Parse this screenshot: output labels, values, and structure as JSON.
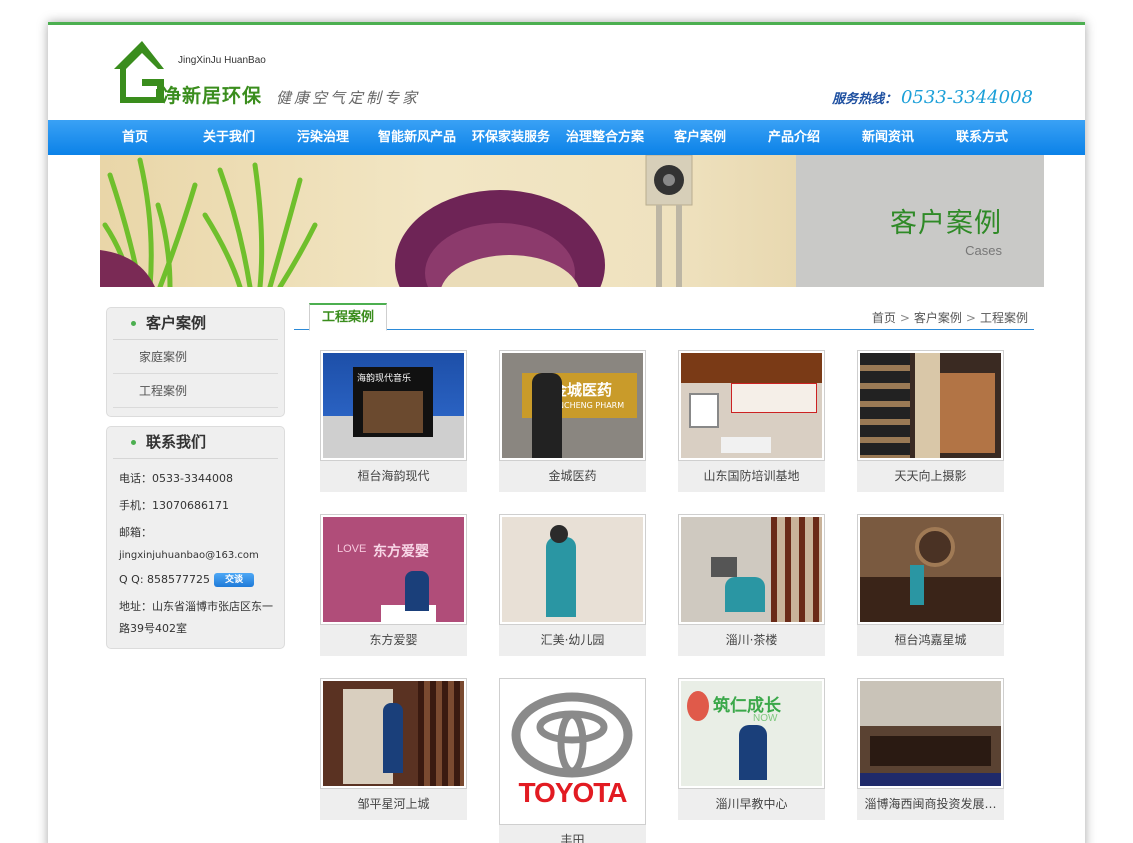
{
  "header": {
    "logo_en": "JingXinJu HuanBao",
    "logo_cn": "净新居环保",
    "slogan": "健康空气定制专家",
    "hotline_label": "服务热线：",
    "hotline_number": "0533-3344008"
  },
  "nav": [
    "首页",
    "关于我们",
    "污染治理",
    "智能新风产品",
    "环保家装服务",
    "治理整合方案",
    "客户案例",
    "产品介绍",
    "新闻资讯",
    "联系方式"
  ],
  "banner": {
    "title": "客户案例",
    "subtitle": "Cases"
  },
  "sidebar": {
    "cases_title": "客户案例",
    "cases_links": [
      "家庭案例",
      "工程案例"
    ],
    "contact_title": "联系我们",
    "contact": {
      "phone": "电话：0533-3344008",
      "mobile": "手机：13070686171",
      "email_label": "邮箱：",
      "email": "jingxinjuhuanbao@163.com",
      "qq": "Q Q:  858577725",
      "qq_badge": "交谈",
      "address": "地址：山东省淄博市张店区东一路39号402室"
    }
  },
  "main": {
    "tab_label": "工程案例",
    "breadcrumb": [
      "首页",
      "客户案例",
      "工程案例"
    ],
    "cases": [
      "桓台海韵现代",
      "金城医药",
      "山东国防培训基地",
      "天天向上摄影",
      "东方爱婴",
      "汇美·幼儿园",
      "淄川·茶楼",
      "桓台鸿嘉星城",
      "邹平星河上城",
      "丰田",
      "淄川早教中心",
      "淄博海西闽商投资发展…"
    ],
    "photo_texts": {
      "haiyun": "海韵现代音乐",
      "jincheng": "金城医药",
      "jincheng_en": "NCHENG PHARM",
      "dongfang": "东方爱婴",
      "love": "LOVE",
      "toyota": "TOYOTA",
      "zhiren": "筑仁成长",
      "now": "NOW"
    }
  },
  "colors": {
    "brand_green": "#3a8d1d",
    "nav_blue": "#0b82e8",
    "accent_green": "#4caf50"
  }
}
